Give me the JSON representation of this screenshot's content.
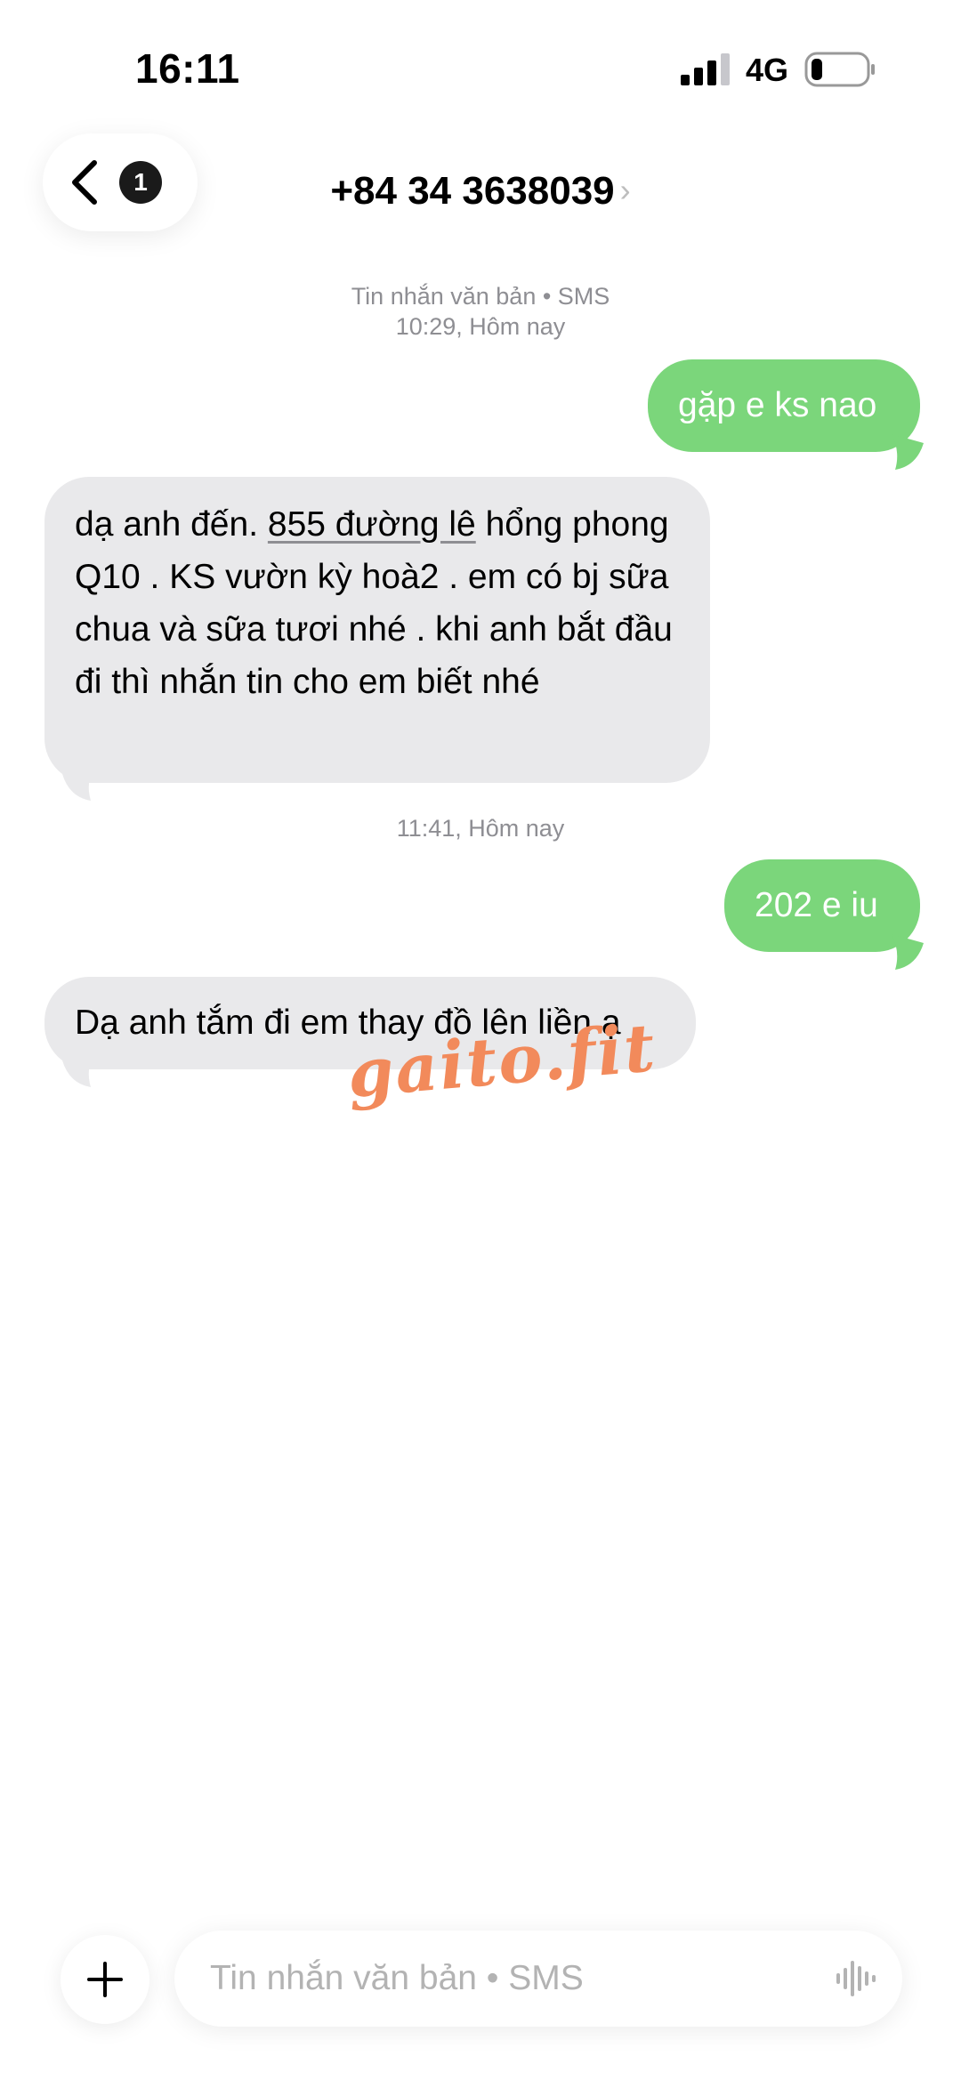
{
  "status_bar": {
    "time": "16:11",
    "network": "4G",
    "signal_icon": "cellular-signal-icon",
    "battery_icon": "battery-icon",
    "battery_level": 0.2
  },
  "header": {
    "back_icon": "chevron-left-icon",
    "unread_badge": "1",
    "contact_name": "+84 34 3638039",
    "contact_chevron": "›"
  },
  "thread": {
    "service_label": "Tin nhắn văn bản • SMS",
    "first_timestamp": "10:29, Hôm nay",
    "second_timestamp": "11:41, Hôm nay",
    "messages": [
      {
        "direction": "outgoing",
        "text": "gặp e ks nao"
      },
      {
        "direction": "incoming",
        "text_before_link": "dạ anh đến.  ",
        "link": "855 đường lê",
        "text_after_link": " hổng phong Q10 . KS  vườn kỳ hoà2 . em có bj sữa chua và sữa tươi nhé .  khi anh bắt đầu đi thì nhắn tin cho em biết nhé"
      },
      {
        "direction": "outgoing",
        "text": "202 e iu"
      },
      {
        "direction": "incoming",
        "text": "Dạ anh tắm đi em thay đồ lên liền ạ"
      }
    ]
  },
  "watermark": "gaito.fit",
  "composer": {
    "plus_icon": "plus-icon",
    "placeholder": "Tin nhắn văn bản • SMS",
    "value": "",
    "voice_icon": "waveform-icon"
  },
  "colors": {
    "outgoing_bubble": "#7bd67b",
    "incoming_bubble": "#e9e9eb",
    "meta_text": "#8e8e93",
    "watermark": "#f28a5b"
  }
}
